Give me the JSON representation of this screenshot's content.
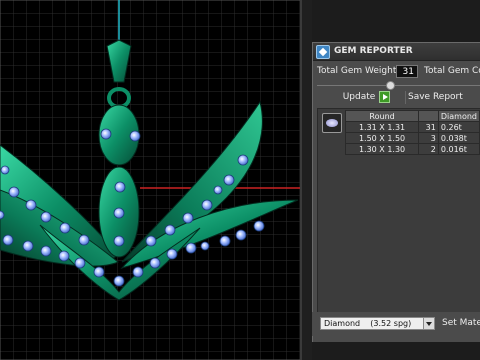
{
  "panel": {
    "title": "GEM REPORTER",
    "total_gem_weight_label": "Total Gem Weight",
    "total_gem_weight_value": "31",
    "total_gem_count_label": "Total Gem Cou",
    "update_label": "Update",
    "save_report_label": "Save Report"
  },
  "table": {
    "columns": [
      "Round",
      "",
      "Diamond"
    ],
    "rows": [
      [
        "1.31 X 1.31",
        "31",
        "0.26t"
      ],
      [
        "1.50 X 1.50",
        "3",
        "0.038t"
      ],
      [
        "1.30 X 1.30",
        "2",
        "0.016t"
      ]
    ]
  },
  "footer": {
    "material_value": "Diamond    (3.52 spg)",
    "set_material_label": "Set Mater"
  },
  "colors": {
    "viewport_bg": "#000000",
    "grid_line": "#2d2d2d",
    "model_green": "#0d8f66",
    "gem_blue": "#7fa3ff",
    "axis_red": "#cc2222",
    "axis_cyan": "#22bbcc",
    "panel_bg": "#4b4b4b"
  },
  "icons": [
    "gem-reporter-icon",
    "play-icon",
    "gem-thumbnail-icon",
    "dropdown-arrow-icon"
  ]
}
